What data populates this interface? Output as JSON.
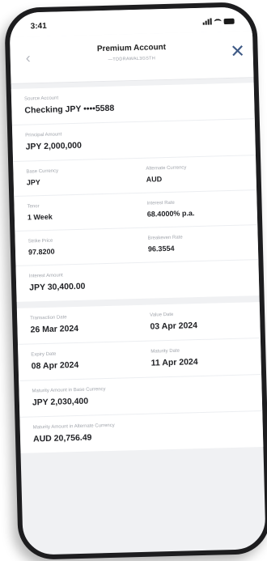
{
  "status_bar": {
    "time": "3:41"
  },
  "header": {
    "title": "Premium Account",
    "subtitle": "—TDDRAWAL3GSTH"
  },
  "account": {
    "source_label": "Source Account",
    "source_value": "Checking JPY ••••5588",
    "principal_label": "Principal Amount",
    "principal_value": "JPY 2,000,000",
    "base_currency_label": "Base Currency",
    "base_currency_value": "JPY",
    "alt_currency_label": "Alternate Currency",
    "alt_currency_value": "AUD",
    "tenor_label": "Tenor",
    "tenor_value": "1 Week",
    "interest_rate_label": "Interest Rate",
    "interest_rate_value": "68.4000% p.a.",
    "strike_label": "Strike Price",
    "strike_value": "97.8200",
    "breakeven_label": "Breakeven Rate",
    "breakeven_value": "96.3554",
    "interest_amount_label": "Interest Amount",
    "interest_amount_value": "JPY 30,400.00"
  },
  "dates": {
    "transaction_label": "Transaction Date",
    "transaction_value": "26 Mar 2024",
    "value_date_label": "Value Date",
    "value_date_value": "03 Apr 2024",
    "expiry_label": "Expiry Date",
    "expiry_value": "08 Apr 2024",
    "maturity_label": "Maturity Date",
    "maturity_value": "11 Apr 2024",
    "maturity_base_label": "Maturity Amount in Base Currency",
    "maturity_base_value": "JPY 2,030,400",
    "maturity_alt_label": "Maturity Amount in Alternate Currency",
    "maturity_alt_value": "AUD 20,756.49"
  },
  "icons": {
    "back": "chevron-left-icon",
    "close": "close-icon"
  }
}
